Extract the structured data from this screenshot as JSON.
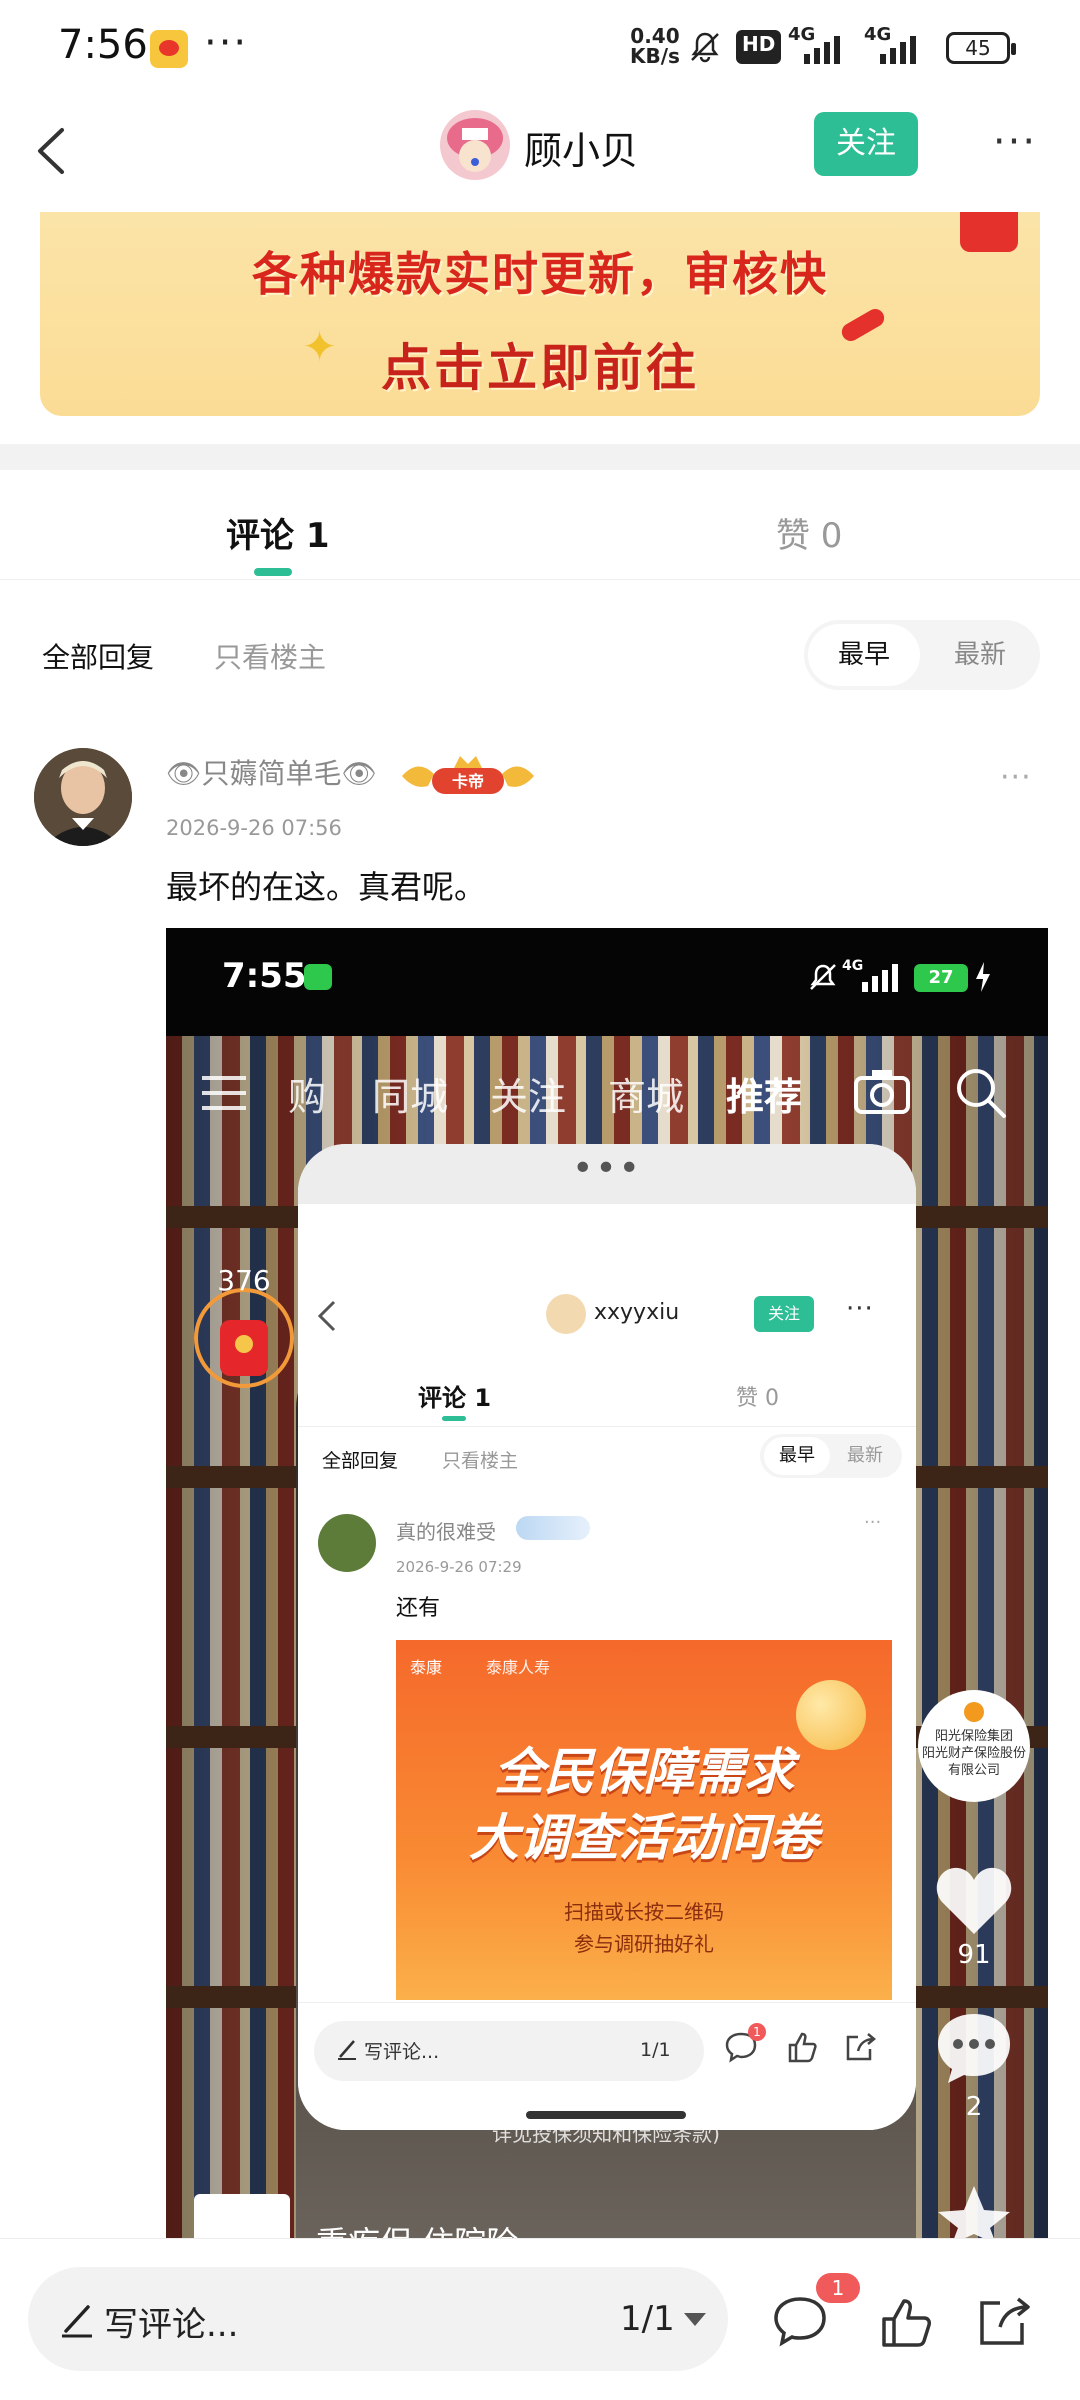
{
  "status_bar": {
    "time": "7:56",
    "dots": "···",
    "speed_value": "0.40",
    "speed_unit": "KB/s",
    "hd": "HD",
    "net1": "4G",
    "net2": "4G",
    "battery": "45"
  },
  "header": {
    "username": "顾小贝",
    "follow_label": "关注",
    "more": "···"
  },
  "banner": {
    "line1": "各种爆款实时更新，审核快",
    "line2": "点击立即前往",
    "sparkle": "✦"
  },
  "tabs": {
    "comments": "评论 1",
    "likes": "赞 0"
  },
  "filters": {
    "all_replies": "全部回复",
    "op_only": "只看楼主",
    "sort_earliest": "最早",
    "sort_newest": "最新"
  },
  "comment": {
    "username": "👁只薅简单毛👁",
    "badge": "卡帝",
    "date": "2026-9-26 07:56",
    "text": "最坏的在这。真君呢。",
    "more": "···"
  },
  "screenshot": {
    "time": "7:55",
    "signal": "4G",
    "battery": "27",
    "nav": [
      "购",
      "同城",
      "关注",
      "商城",
      "推荐"
    ],
    "red_count": "376",
    "popup": {
      "dots": "•••",
      "username": "xxyyxiu",
      "follow": "关注",
      "more": "···",
      "tab_comments": "评论 1",
      "tab_likes": "赞 0",
      "filter_all": "全部回复",
      "filter_op": "只看楼主",
      "sort_a": "最早",
      "sort_b": "最新",
      "comment_name": "真的很难受",
      "comment_more": "···",
      "comment_date": "2026-9-26 07:29",
      "comment_text": "还有",
      "ad": {
        "logo1": "泰康",
        "logo2": "泰康人寿",
        "headline1": "全民保障需求",
        "headline2": "大调查活动问卷",
        "sub1": "扫描或长按二维码",
        "sub2": "参与调研抽好礼"
      },
      "input_placeholder": "写评论...",
      "page": "1/1",
      "comment_badge": "1"
    },
    "sunshine_label": "阳光保险集团\n阳光财产保险股份有限公司",
    "likes": "91",
    "comments": "2",
    "footer_text": "详见投保须知和保险条款)",
    "footer_title": "重疾保 住院险"
  },
  "bottom_bar": {
    "placeholder": "写评论...",
    "page": "1/1",
    "comment_badge": "1"
  },
  "colors": {
    "accent": "#2dbe96",
    "badge_red": "#f05a5a"
  }
}
